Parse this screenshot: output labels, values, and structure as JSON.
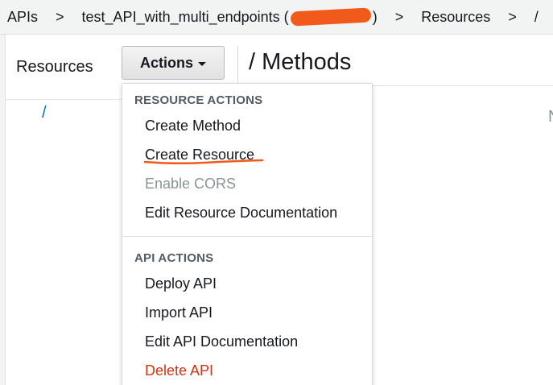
{
  "breadcrumb": {
    "items": [
      "APIs",
      "test_API_with_multi_endpoints (",
      ")",
      "Resources",
      "/"
    ],
    "separator": ">"
  },
  "left_panel": {
    "title": "Resources",
    "actions_label": "Actions",
    "root_resource": "/"
  },
  "main": {
    "title": "/ Methods",
    "cut_text": "N"
  },
  "dropdown": {
    "resource_section": "RESOURCE ACTIONS",
    "resource_items": [
      "Create Method",
      "Create Resource",
      "Enable CORS",
      "Edit Resource Documentation"
    ],
    "api_section": "API ACTIONS",
    "api_items": [
      "Deploy API",
      "Import API",
      "Edit API Documentation",
      "Delete API"
    ]
  },
  "colors": {
    "accent_link": "#0073bb",
    "danger": "#d13212",
    "annotation": "#f25a1b",
    "disabled": "#879596"
  }
}
